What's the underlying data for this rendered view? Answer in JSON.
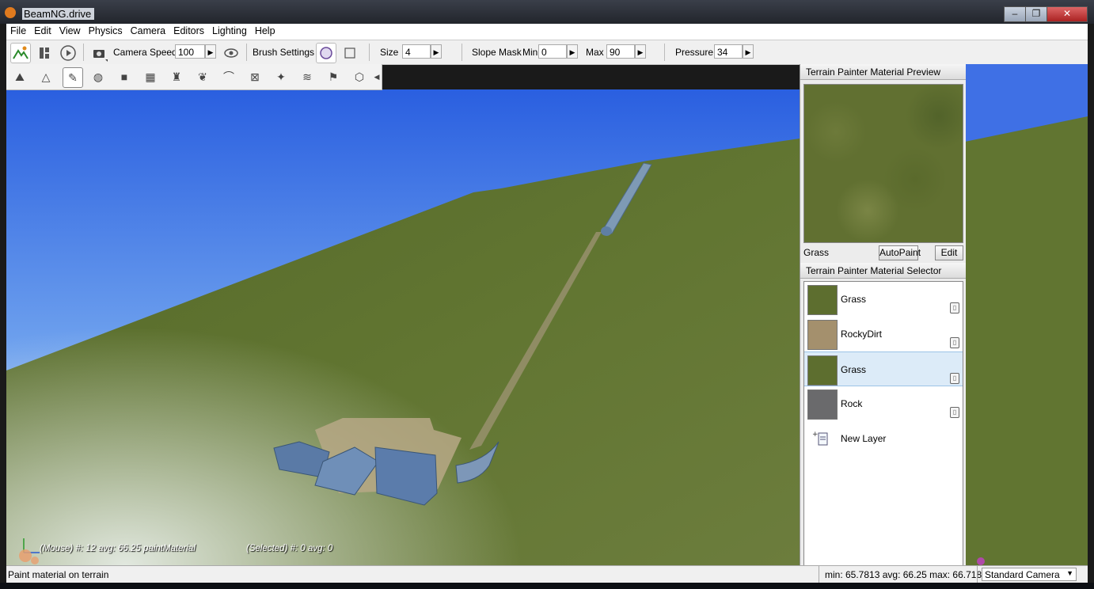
{
  "window": {
    "title": "BeamNG.drive",
    "minimize": "‒",
    "maximize": "❐",
    "close": "✕"
  },
  "menu": [
    "File",
    "Edit",
    "View",
    "Physics",
    "Camera",
    "Editors",
    "Lighting",
    "Help"
  ],
  "toolbar": {
    "camera_speed_label": "Camera Speed",
    "camera_speed_value": "100",
    "brush_settings_label": "Brush Settings",
    "size_label": "Size",
    "size_value": "4",
    "slope_mask_label": "Slope Mask",
    "min_label": "Min",
    "min_value": "0",
    "max_label": "Max",
    "max_value": "90",
    "pressure_label": "Pressure",
    "pressure_value": "34",
    "arrow": "▶"
  },
  "palette_icons": [
    "raise-terrain-icon",
    "smooth-terrain-icon",
    "paint-material-icon",
    "globe-icon",
    "object-icon",
    "data-icon",
    "stamp-icon",
    "feather-icon",
    "curve-icon",
    "select-box-icon",
    "pointer-icon",
    "road-icon",
    "flag-icon",
    "gizmo-icon"
  ],
  "preview_panel": {
    "title": "Terrain Painter Material Preview",
    "material_name": "Grass",
    "autopaint_label": "AutoPaint",
    "edit_label": "Edit"
  },
  "selector_panel": {
    "title": "Terrain Painter Material Selector",
    "materials": [
      {
        "name": "Grass",
        "swatch": "#5d6e2f",
        "selected": false
      },
      {
        "name": "RockyDirt",
        "swatch": "#a4906d",
        "selected": false
      },
      {
        "name": "Grass",
        "swatch": "#5d6e2f",
        "selected": true
      },
      {
        "name": "Rock",
        "swatch": "#6a6a6c",
        "selected": false
      }
    ],
    "new_layer_label": "New Layer"
  },
  "viewport_overlay": {
    "mouse_text": "(Mouse) #: 12  avg: 66.25 paintMaterial",
    "selected_text": "(Selected) #: 0  avg: 0"
  },
  "status": {
    "hint": "Paint material on terrain",
    "stats": "min: 65.7813  avg: 66.25  max: 66.718",
    "camera_mode": "Standard Camera"
  },
  "colors": {
    "sky_top": "#2a5fe0",
    "sky_bottom": "#c8def5",
    "terrain": "#5f7330",
    "selection": "#dcebf8"
  }
}
